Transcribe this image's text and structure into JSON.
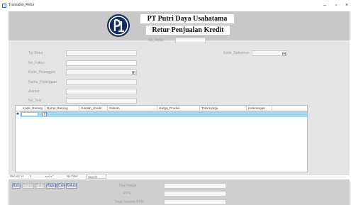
{
  "window": {
    "title": "Transaksi_Retur",
    "minimize_glyph": "–",
    "maximize_glyph": "▫",
    "close_glyph": "×"
  },
  "header": {
    "logo_icon": "company-logo-icon",
    "company_name": "PT Putri Daya Usahatama",
    "form_title": "Retur Penjualan Kredit"
  },
  "form": {
    "no_retur_label": "No_Retur",
    "fields_left": [
      {
        "label": "Tgl Retur",
        "value": ""
      },
      {
        "label": "No_Faktur",
        "value": ""
      },
      {
        "label": "Kode_Pelanggan",
        "value": "",
        "dropdown": true
      },
      {
        "label": "Nama_Pelanggan",
        "value": ""
      },
      {
        "label": "Alamat",
        "value": ""
      },
      {
        "label": "No_Telp",
        "value": ""
      }
    ],
    "kode_salesman_label": "Kode_Salesman"
  },
  "grid": {
    "columns": [
      "Kode_Barang",
      "Nama_Barang",
      "Jumlah_Kredit",
      "Satuan",
      "Harga_Produk",
      "Total Harga",
      "Keterangan"
    ],
    "row_selector_glyph": "✱",
    "dropdown_glyph": "▾"
  },
  "navigation": {
    "record_label": "Record: H",
    "record_pos": "1",
    "nav_arrows": "▸ ▸| ▸*",
    "filter_label": "No Filter",
    "search_placeholder": "Search"
  },
  "buttons": [
    {
      "label": "Baru",
      "enabled": true
    },
    {
      "label": "Simpan",
      "enabled": false
    },
    {
      "label": "Batal",
      "enabled": false
    },
    {
      "label": "Hapus",
      "enabled": true
    },
    {
      "label": "Cari",
      "enabled": true
    },
    {
      "label": "Keluar",
      "enabled": true
    }
  ],
  "totals": {
    "labels": [
      "Total Harga",
      "PPN",
      "Total Setelah PPN"
    ]
  },
  "colors": {
    "header_bg": "#c8c8c8",
    "form_bg": "#e4e4e4",
    "selected_row": "#a5d7f3",
    "logo_bg": "#142a5c"
  }
}
